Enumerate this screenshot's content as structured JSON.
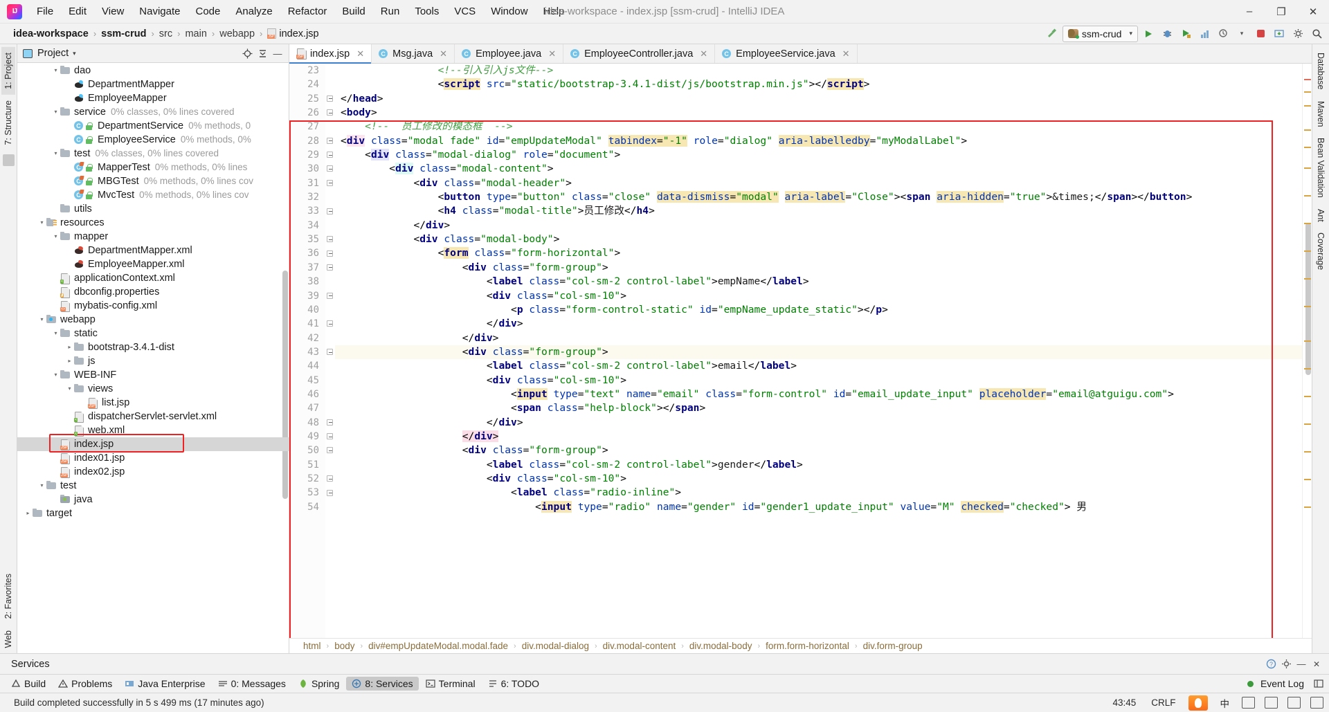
{
  "window": {
    "title": "idea-workspace - index.jsp [ssm-crud] - IntelliJ IDEA",
    "minimize": "–",
    "maximize": "❐",
    "close": "✕"
  },
  "menu": [
    {
      "label": "File"
    },
    {
      "label": "Edit"
    },
    {
      "label": "View"
    },
    {
      "label": "Navigate"
    },
    {
      "label": "Code"
    },
    {
      "label": "Analyze"
    },
    {
      "label": "Refactor"
    },
    {
      "label": "Build"
    },
    {
      "label": "Run"
    },
    {
      "label": "Tools"
    },
    {
      "label": "VCS"
    },
    {
      "label": "Window"
    },
    {
      "label": "Help"
    }
  ],
  "breadcrumb": {
    "items": [
      "idea-workspace",
      "ssm-crud",
      "src",
      "main",
      "webapp",
      "index.jsp"
    ],
    "separator": "›",
    "file_icon": "jsp-file-icon"
  },
  "navbar_right": {
    "hammer_icon": "build-hammer-icon",
    "run_config": "ssm-crud",
    "run_icon": "run-icon",
    "debug_icon": "debug-icon",
    "run_coverage_icon": "run-with-coverage-icon",
    "profile_icon": "profiler-icon",
    "attach_icon": "attach-debugger-icon",
    "stop_icon": "stop-icon",
    "update_icon": "update-app-icon",
    "settings_icon": "settings-icon",
    "search_icon": "search-everywhere-icon"
  },
  "left_rail": {
    "tabs": [
      "1: Project",
      "7: Structure"
    ],
    "bottom_tabs": [
      "2: Favorites",
      "Web"
    ]
  },
  "right_rail": {
    "tabs": [
      "Database",
      "Maven",
      "Bean Validation",
      "Ant",
      "Coverage"
    ]
  },
  "project_panel": {
    "title": "Project",
    "caret": "▾",
    "buttons": [
      "locate-icon",
      "collapse-all-icon",
      "hide-icon"
    ],
    "tree": [
      {
        "indent": 4,
        "arrow": "▾",
        "icon": "folder",
        "label": "dao",
        "cov": ""
      },
      {
        "indent": 5,
        "arrow": "",
        "icon": "mybatis",
        "label": "DepartmentMapper",
        "cov": ""
      },
      {
        "indent": 5,
        "arrow": "",
        "icon": "mybatis",
        "label": "EmployeeMapper",
        "cov": ""
      },
      {
        "indent": 4,
        "arrow": "▾",
        "icon": "folder",
        "label": "service",
        "cov": "0% classes, 0% lines covered"
      },
      {
        "indent": 5,
        "arrow": "",
        "icon": "class-lock",
        "label": "DepartmentService",
        "cov": "0% methods, 0"
      },
      {
        "indent": 5,
        "arrow": "",
        "icon": "class-lock",
        "label": "EmployeeService",
        "cov": "0% methods, 0%"
      },
      {
        "indent": 4,
        "arrow": "▾",
        "icon": "folder",
        "label": "test",
        "cov": "0% classes, 0% lines covered"
      },
      {
        "indent": 5,
        "arrow": "",
        "icon": "class-test-lock",
        "label": "MapperTest",
        "cov": "0% methods, 0% lines"
      },
      {
        "indent": 5,
        "arrow": "",
        "icon": "class-test-lock",
        "label": "MBGTest",
        "cov": "0% methods, 0% lines cov"
      },
      {
        "indent": 5,
        "arrow": "",
        "icon": "class-test-lock",
        "label": "MvcTest",
        "cov": "0% methods, 0% lines cov"
      },
      {
        "indent": 4,
        "arrow": "",
        "icon": "folder",
        "label": "utils",
        "cov": ""
      },
      {
        "indent": 3,
        "arrow": "▾",
        "icon": "folder-resources",
        "label": "resources",
        "cov": ""
      },
      {
        "indent": 4,
        "arrow": "▾",
        "icon": "folder",
        "label": "mapper",
        "cov": ""
      },
      {
        "indent": 5,
        "arrow": "",
        "icon": "mybatis-xml",
        "label": "DepartmentMapper.xml",
        "cov": ""
      },
      {
        "indent": 5,
        "arrow": "",
        "icon": "mybatis-xml",
        "label": "EmployeeMapper.xml",
        "cov": ""
      },
      {
        "indent": 4,
        "arrow": "",
        "icon": "spring-xml",
        "label": "applicationContext.xml",
        "cov": ""
      },
      {
        "indent": 4,
        "arrow": "",
        "icon": "properties",
        "label": "dbconfig.properties",
        "cov": ""
      },
      {
        "indent": 4,
        "arrow": "",
        "icon": "mybatis-config",
        "label": "mybatis-config.xml",
        "cov": ""
      },
      {
        "indent": 3,
        "arrow": "▾",
        "icon": "folder-web",
        "label": "webapp",
        "cov": ""
      },
      {
        "indent": 4,
        "arrow": "▾",
        "icon": "folder",
        "label": "static",
        "cov": ""
      },
      {
        "indent": 5,
        "arrow": "▸",
        "icon": "folder",
        "label": "bootstrap-3.4.1-dist",
        "cov": ""
      },
      {
        "indent": 5,
        "arrow": "▸",
        "icon": "folder",
        "label": "js",
        "cov": ""
      },
      {
        "indent": 4,
        "arrow": "▾",
        "icon": "folder",
        "label": "WEB-INF",
        "cov": ""
      },
      {
        "indent": 5,
        "arrow": "▾",
        "icon": "folder",
        "label": "views",
        "cov": ""
      },
      {
        "indent": 6,
        "arrow": "",
        "icon": "jsp",
        "label": "list.jsp",
        "cov": ""
      },
      {
        "indent": 5,
        "arrow": "",
        "icon": "spring-xml",
        "label": "dispatcherServlet-servlet.xml",
        "cov": ""
      },
      {
        "indent": 5,
        "arrow": "",
        "icon": "spring-xml",
        "label": "web.xml",
        "cov": ""
      },
      {
        "indent": 4,
        "arrow": "",
        "icon": "jsp",
        "label": "index.jsp",
        "cov": "",
        "selected": true,
        "boxed": true
      },
      {
        "indent": 4,
        "arrow": "",
        "icon": "jsp",
        "label": "index01.jsp",
        "cov": ""
      },
      {
        "indent": 4,
        "arrow": "",
        "icon": "jsp",
        "label": "index02.jsp",
        "cov": ""
      },
      {
        "indent": 3,
        "arrow": "▾",
        "icon": "folder",
        "label": "test",
        "cov": ""
      },
      {
        "indent": 4,
        "arrow": "",
        "icon": "folder-src-test",
        "label": "java",
        "cov": ""
      },
      {
        "indent": 2,
        "arrow": "▸",
        "icon": "folder",
        "label": "target",
        "cov": ""
      }
    ]
  },
  "editor": {
    "tabs": [
      {
        "label": "index.jsp",
        "icon": "jsp",
        "active": true
      },
      {
        "label": "Msg.java",
        "icon": "java",
        "active": false
      },
      {
        "label": "Employee.java",
        "icon": "java",
        "active": false
      },
      {
        "label": "EmployeeController.java",
        "icon": "java",
        "active": false
      },
      {
        "label": "EmployeeService.java",
        "icon": "java",
        "active": false
      }
    ],
    "close_glyph": "✕",
    "first_line_number": 23,
    "lines": [
      {
        "n": 23,
        "indent": 4,
        "html": "<span class=\"cm\">&lt;!--引入引入js文件--&gt;</span>"
      },
      {
        "n": 24,
        "indent": 4,
        "html": "<span class=\"pt\">&lt;</span><span class=\"t hlk\">script</span> <span class=\"a\">src</span><span class=\"pt\">=</span><span class=\"s\">\"static/bootstrap-3.4.1-dist/js/bootstrap.min.js\"</span><span class=\"pt\">&gt;&lt;/</span><span class=\"t hlk\">script</span><span class=\"pt\">&gt;</span>"
      },
      {
        "n": 25,
        "indent": 0,
        "html": "<span class=\"pt\">&lt;/</span><span class=\"t\">head</span><span class=\"pt\">&gt;</span>"
      },
      {
        "n": 26,
        "indent": 0,
        "html": "<span class=\"pt\">&lt;</span><span class=\"t\">body</span><span class=\"pt\">&gt;</span>"
      },
      {
        "n": 27,
        "indent": 1,
        "html": "<span class=\"cm\">&lt;!--  员工修改的模态框  --&gt;</span>"
      },
      {
        "n": 28,
        "indent": 0,
        "html": "<span class=\"pt\">&lt;</span><span class=\"t hlg\">div</span> <span class=\"a\">class</span><span class=\"pt\">=</span><span class=\"s\">\"modal fade\"</span> <span class=\"a\">id</span><span class=\"pt\">=</span><span class=\"s\">\"empUpdateModal\"</span> <span class=\"a hlk\">tabindex</span><span class=\"pt hlk\">=</span><span class=\"s hlk\">\"-1\"</span> <span class=\"a\">role</span><span class=\"pt\">=</span><span class=\"s\">\"dialog\"</span> <span class=\"a hlk\">aria-labelledby</span><span class=\"pt\">=</span><span class=\"s\">\"myModalLabel\"</span><span class=\"pt\">&gt;</span>"
      },
      {
        "n": 29,
        "indent": 1,
        "html": "<span class=\"pt\">&lt;</span><span class=\"t hlb\">div</span> <span class=\"a\">class</span><span class=\"pt\">=</span><span class=\"s\">\"modal-dialog\"</span> <span class=\"a\">role</span><span class=\"pt\">=</span><span class=\"s\">\"document\"</span><span class=\"pt\">&gt;</span>"
      },
      {
        "n": 30,
        "indent": 2,
        "html": "<span class=\"pt\">&lt;</span><span class=\"t hlc\">div</span> <span class=\"a\">class</span><span class=\"pt\">=</span><span class=\"s\">\"modal-content\"</span><span class=\"pt\">&gt;</span>"
      },
      {
        "n": 31,
        "indent": 3,
        "html": "<span class=\"pt\">&lt;</span><span class=\"t\">div</span> <span class=\"a\">class</span><span class=\"pt\">=</span><span class=\"s\">\"modal-header\"</span><span class=\"pt\">&gt;</span>"
      },
      {
        "n": 32,
        "indent": 4,
        "html": "<span class=\"pt\">&lt;</span><span class=\"t\">button</span> <span class=\"a\">type</span><span class=\"pt\">=</span><span class=\"s\">\"button\"</span> <span class=\"a\">class</span><span class=\"pt\">=</span><span class=\"s\">\"close\"</span> <span class=\"a hlk\">data-dismiss</span><span class=\"pt hlk\">=</span><span class=\"s hlk\">\"modal\"</span> <span class=\"a hlk\">aria-label</span><span class=\"pt\">=</span><span class=\"s\">\"Close\"</span><span class=\"pt\">&gt;&lt;</span><span class=\"t\">span</span> <span class=\"a hlk\">aria-hidden</span><span class=\"pt\">=</span><span class=\"s\">\"true\"</span><span class=\"pt\">&gt;</span>&amp;times;<span class=\"pt\">&lt;/</span><span class=\"t\">span</span><span class=\"pt\">&gt;&lt;/</span><span class=\"t\">button</span><span class=\"pt\">&gt;</span>"
      },
      {
        "n": 33,
        "indent": 4,
        "html": "<span class=\"pt\">&lt;</span><span class=\"t\">h4</span> <span class=\"a\">class</span><span class=\"pt\">=</span><span class=\"s\">\"modal-title\"</span><span class=\"pt\">&gt;</span>员工修改<span class=\"pt\">&lt;/</span><span class=\"t\">h4</span><span class=\"pt\">&gt;</span>"
      },
      {
        "n": 34,
        "indent": 3,
        "html": "<span class=\"pt\">&lt;/</span><span class=\"t\">div</span><span class=\"pt\">&gt;</span>"
      },
      {
        "n": 35,
        "indent": 3,
        "html": "<span class=\"pt\">&lt;</span><span class=\"t\">div</span> <span class=\"a\">class</span><span class=\"pt\">=</span><span class=\"s\">\"modal-body\"</span><span class=\"pt\">&gt;</span>"
      },
      {
        "n": 36,
        "indent": 4,
        "html": "<span class=\"pt\">&lt;</span><span class=\"t hlk\">form</span> <span class=\"a\">class</span><span class=\"pt\">=</span><span class=\"s\">\"form-horizontal\"</span><span class=\"pt\">&gt;</span>"
      },
      {
        "n": 37,
        "indent": 5,
        "html": "<span class=\"pt\">&lt;</span><span class=\"t\">div</span> <span class=\"a\">class</span><span class=\"pt\">=</span><span class=\"s\">\"form-group\"</span><span class=\"pt\">&gt;</span>"
      },
      {
        "n": 38,
        "indent": 6,
        "html": "<span class=\"pt\">&lt;</span><span class=\"t\">label</span> <span class=\"a\">class</span><span class=\"pt\">=</span><span class=\"s\">\"col-sm-2 control-label\"</span><span class=\"pt\">&gt;</span>empName<span class=\"pt\">&lt;/</span><span class=\"t\">label</span><span class=\"pt\">&gt;</span>"
      },
      {
        "n": 39,
        "indent": 6,
        "html": "<span class=\"pt\">&lt;</span><span class=\"t\">div</span> <span class=\"a\">class</span><span class=\"pt\">=</span><span class=\"s\">\"col-sm-10\"</span><span class=\"pt\">&gt;</span>"
      },
      {
        "n": 40,
        "indent": 7,
        "html": "<span class=\"pt\">&lt;</span><span class=\"t\">p</span> <span class=\"a\">class</span><span class=\"pt\">=</span><span class=\"s\">\"form-control-static\"</span> <span class=\"a\">id</span><span class=\"pt\">=</span><span class=\"s\">\"empName_update_static\"</span><span class=\"pt\">&gt;&lt;/</span><span class=\"t\">p</span><span class=\"pt\">&gt;</span>"
      },
      {
        "n": 41,
        "indent": 6,
        "html": "<span class=\"pt\">&lt;/</span><span class=\"t\">div</span><span class=\"pt\">&gt;</span>"
      },
      {
        "n": 42,
        "indent": 5,
        "html": "<span class=\"pt\">&lt;/</span><span class=\"t\">div</span><span class=\"pt\">&gt;</span>"
      },
      {
        "n": 43,
        "indent": 5,
        "html": "<span class=\"pt\">&lt;</span><span class=\"t\">div</span> <span class=\"a\">class</span><span class=\"pt\">=</span><span class=\"s\">\"form-group\"</span><span class=\"pt\">&gt;</span>",
        "highlight": true,
        "bulb": true
      },
      {
        "n": 44,
        "indent": 6,
        "html": "<span class=\"pt\">&lt;</span><span class=\"t\">label</span> <span class=\"a\">class</span><span class=\"pt\">=</span><span class=\"s\">\"col-sm-2 control-label\"</span><span class=\"pt\">&gt;</span>email<span class=\"pt\">&lt;/</span><span class=\"t\">label</span><span class=\"pt\">&gt;</span>"
      },
      {
        "n": 45,
        "indent": 6,
        "html": "<span class=\"pt\">&lt;</span><span class=\"t\">div</span> <span class=\"a\">class</span><span class=\"pt\">=</span><span class=\"s\">\"col-sm-10\"</span><span class=\"pt\">&gt;</span>"
      },
      {
        "n": 46,
        "indent": 7,
        "html": "<span class=\"pt\">&lt;</span><span class=\"t hlk\">input</span> <span class=\"a\">type</span><span class=\"pt\">=</span><span class=\"s\">\"text\"</span> <span class=\"a\">name</span><span class=\"pt\">=</span><span class=\"s\">\"email\"</span> <span class=\"a\">class</span><span class=\"pt\">=</span><span class=\"s\">\"form-control\"</span> <span class=\"a\">id</span><span class=\"pt\">=</span><span class=\"s\">\"email_update_input\"</span> <span class=\"a hlk\">placeholder</span><span class=\"pt\">=</span><span class=\"s\">\"email@atguigu.com\"</span><span class=\"pt\">&gt;</span>"
      },
      {
        "n": 47,
        "indent": 7,
        "html": "<span class=\"pt\">&lt;</span><span class=\"t\">span</span> <span class=\"a\">class</span><span class=\"pt\">=</span><span class=\"s\">\"help-block\"</span><span class=\"pt\">&gt;&lt;/</span><span class=\"t\">span</span><span class=\"pt\">&gt;</span>"
      },
      {
        "n": 48,
        "indent": 6,
        "html": "<span class=\"pt\">&lt;/</span><span class=\"t\">div</span><span class=\"pt\">&gt;</span>"
      },
      {
        "n": 49,
        "indent": 5,
        "html": "<span class=\"pt hlm\">&lt;/</span><span class=\"t hlm\">div</span><span class=\"pt hlm\">&gt;</span>"
      },
      {
        "n": 50,
        "indent": 5,
        "html": "<span class=\"pt\">&lt;</span><span class=\"t\">div</span> <span class=\"a\">class</span><span class=\"pt\">=</span><span class=\"s\">\"form-group\"</span><span class=\"pt\">&gt;</span>"
      },
      {
        "n": 51,
        "indent": 6,
        "html": "<span class=\"pt\">&lt;</span><span class=\"t\">label</span> <span class=\"a\">class</span><span class=\"pt\">=</span><span class=\"s\">\"col-sm-2 control-label\"</span><span class=\"pt\">&gt;</span>gender<span class=\"pt\">&lt;/</span><span class=\"t\">label</span><span class=\"pt\">&gt;</span>"
      },
      {
        "n": 52,
        "indent": 6,
        "html": "<span class=\"pt\">&lt;</span><span class=\"t\">div</span> <span class=\"a\">class</span><span class=\"pt\">=</span><span class=\"s\">\"col-sm-10\"</span><span class=\"pt\">&gt;</span>"
      },
      {
        "n": 53,
        "indent": 7,
        "html": "<span class=\"pt\">&lt;</span><span class=\"t\">label</span> <span class=\"a\">class</span><span class=\"pt\">=</span><span class=\"s\">\"radio-inline\"</span><span class=\"pt\">&gt;</span>"
      },
      {
        "n": 54,
        "indent": 8,
        "html": "<span class=\"pt\">&lt;</span><span class=\"t hlk\">input</span> <span class=\"a\">type</span><span class=\"pt\">=</span><span class=\"s\">\"radio\"</span> <span class=\"a\">name</span><span class=\"pt\">=</span><span class=\"s\">\"gender\"</span> <span class=\"a\">id</span><span class=\"pt\">=</span><span class=\"s\">\"gender1_update_input\"</span> <span class=\"a\">value</span><span class=\"pt\">=</span><span class=\"s\">\"M\"</span> <span class=\"a hlk\">checked</span><span class=\"pt\">=</span><span class=\"s\">\"checked\"</span><span class=\"pt\">&gt;</span> 男"
      }
    ],
    "breadcrumb_trail": [
      "html",
      "body",
      "div#empUpdateModal.modal.fade",
      "div.modal-dialog",
      "div.modal-content",
      "div.modal-body",
      "form.form-horizontal",
      "div.form-group"
    ],
    "breadcrumb_sep": "›"
  },
  "services_panel": {
    "title": "Services",
    "buttons": [
      "help-icon",
      "settings-icon",
      "minimize-icon",
      "hide-icon"
    ]
  },
  "toolwindow_bar": {
    "items": [
      {
        "label": "Build",
        "icon": "build-icon",
        "active": false
      },
      {
        "label": "Problems",
        "icon": "problems-icon",
        "active": false
      },
      {
        "label": "Java Enterprise",
        "icon": "java-enterprise-icon",
        "active": false
      },
      {
        "label": "0: Messages",
        "icon": "messages-icon",
        "active": false
      },
      {
        "label": "Spring",
        "icon": "spring-icon",
        "active": false
      },
      {
        "label": "8: Services",
        "icon": "services-icon",
        "active": true
      },
      {
        "label": "Terminal",
        "icon": "terminal-icon",
        "active": false
      },
      {
        "label": "6: TODO",
        "icon": "todo-icon",
        "active": false
      }
    ],
    "event_log": "Event Log",
    "layout_icon": "layout-icon"
  },
  "status_bar": {
    "message": "Build completed successfully in 5 s 499 ms (17 minutes ago)",
    "caret_position": "43:45",
    "line_separator": "CRLF",
    "ime": "中",
    "tray": [
      "sogou-input-icon",
      "keyboard-icon",
      "table-icon",
      "grid-icon",
      "lock-icon"
    ]
  },
  "colors": {
    "accent": "#3d7fd1",
    "annotation_red": "#ee2222",
    "tag": "#000080",
    "attribute": "#0033b3",
    "string": "#008000",
    "comment": "#3f9f3f",
    "coverage_gray": "#9b9b9b"
  }
}
